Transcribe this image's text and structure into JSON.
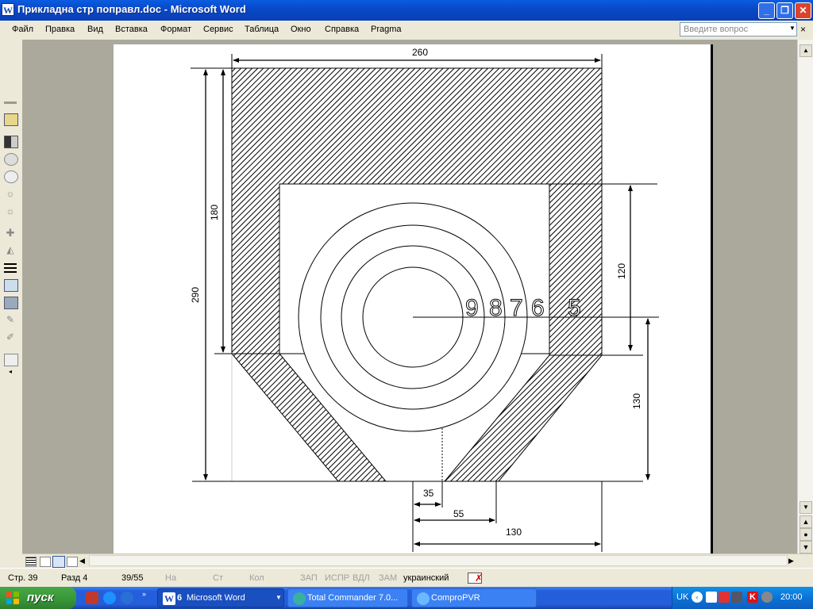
{
  "window": {
    "title": "Прикладна стр поправл.doc - Microsoft Word",
    "app_icon_letter": "W",
    "min_glyph": "_",
    "max_glyph": "❐",
    "close_glyph": "✕"
  },
  "menu": {
    "items": [
      "Файл",
      "Правка",
      "Вид",
      "Вставка",
      "Формат",
      "Сервис",
      "Таблица",
      "Окно",
      "Справка",
      "Pragma"
    ],
    "ask_placeholder": "Введите вопрос",
    "doc_close": "×"
  },
  "drawing": {
    "dimensions": {
      "top_width": "260",
      "upper_height": "180",
      "total_height": "290",
      "window_height": "120",
      "lower_height": "130",
      "outlet_half": "35",
      "outlet_width": "55",
      "bottom_width": "130"
    },
    "ring_labels": [
      "9",
      "8",
      "7",
      "6",
      "5"
    ]
  },
  "status": {
    "page": "Стр. 39",
    "section": "Разд 4",
    "pages": "39/55",
    "at": "На",
    "line": "Ст",
    "col": "Кол",
    "rec": "ЗАП",
    "trk": "ИСПР",
    "ext": "ВДЛ",
    "ovr": "ЗАМ",
    "language": "украинский"
  },
  "taskbar": {
    "start_label": "пуск",
    "tasks": [
      {
        "count": "6",
        "label": "Microsoft Word"
      },
      {
        "label": "Total Commander 7.0..."
      },
      {
        "label": "ComproPVR"
      }
    ],
    "tray": {
      "lang": "UK",
      "clock": "20:00"
    }
  },
  "colors": {
    "titlebar": "#0a49c9",
    "taskbar": "#245edb",
    "start": "#3a9a3a",
    "close": "#d9452c"
  }
}
